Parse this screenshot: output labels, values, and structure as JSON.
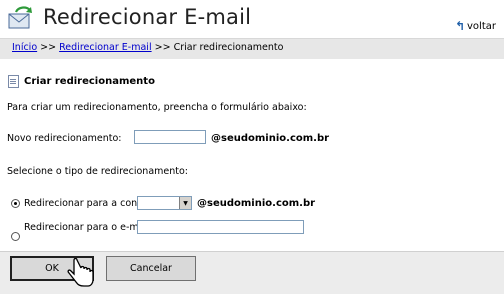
{
  "header": {
    "title": "Redirecionar E-mail",
    "back_label": "voltar"
  },
  "breadcrumb": {
    "home": "Início",
    "sep1": ">>",
    "redirect": "Redirecionar E-mail",
    "sep2": ">>",
    "current": "Criar redirecionamento"
  },
  "section": {
    "title": "Criar redirecionamento"
  },
  "form": {
    "intro": "Para criar um redirecionamento, preencha o formulário abaixo:",
    "new_label": "Novo redirecionamento:",
    "new_value": "",
    "domain": "@seudominio.com.br",
    "type_label": "Selecione o tipo de redirecionamento:",
    "option_account": "Redirecionar para a conta:",
    "account_value": "",
    "option_email": "Redirecionar para o e-mail:",
    "email_value": ""
  },
  "buttons": {
    "ok": "OK",
    "cancel": "Cancelar"
  }
}
